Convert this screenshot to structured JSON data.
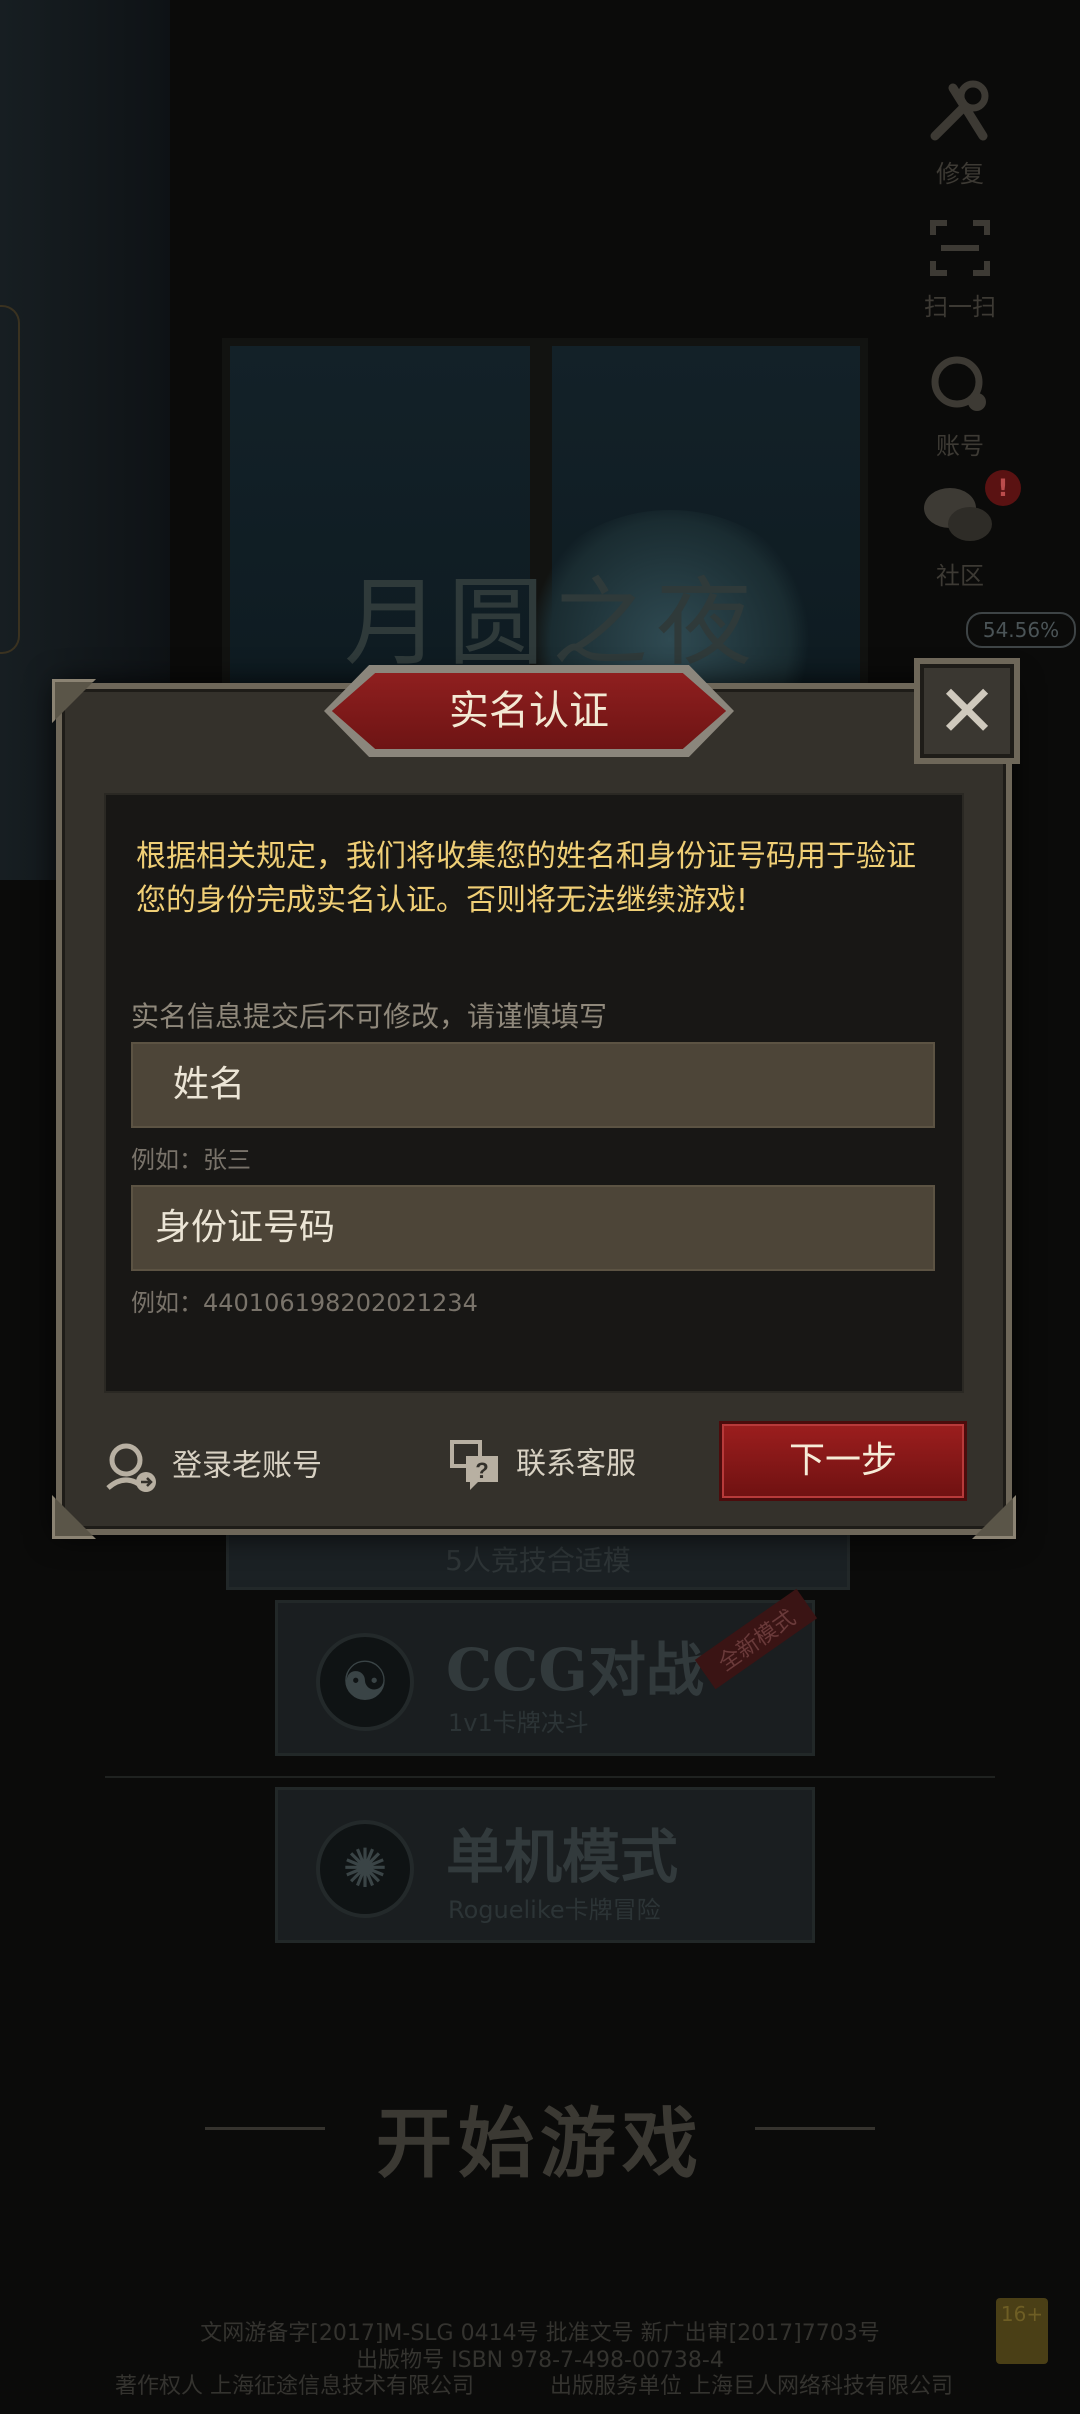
{
  "background": {
    "logo_text": "月圆之夜",
    "side_menu": [
      {
        "label": "修复",
        "icon": "wrench-icon"
      },
      {
        "label": "扫一扫",
        "icon": "scan-icon"
      },
      {
        "label": "账号",
        "icon": "account-gear-icon"
      },
      {
        "label": "社区",
        "icon": "chat-bubbles-icon",
        "badge": "!"
      }
    ],
    "download_progress": "54.56%",
    "partial_button_text": "5人竞技合适模",
    "modes": [
      {
        "title": "CCG对战",
        "subtitle": "1v1卡牌决斗",
        "ribbon": "全新模式",
        "icon": "swirl-emblem-icon"
      },
      {
        "title": "单机模式",
        "subtitle": "Roguelike卡牌冒险",
        "icon": "spiral-emblem-icon"
      }
    ],
    "start_game": "开始游戏",
    "footer": {
      "line1": "文网游备字[2017]M-SLG 0414号 批准文号 新广出审[2017]7703号",
      "line2": "出版物号 ISBN 978-7-498-00738-4",
      "line3_left": "著作权人 上海征途信息技术有限公司",
      "line3_right": "出版服务单位 上海巨人网络科技有限公司",
      "age_rating": "16+"
    }
  },
  "dialog": {
    "title": "实名认证",
    "close_icon": "close-icon",
    "notice": "根据相关规定，我们将收集您的姓名和身份证号码用于验证您的身份完成实名认证。否则将无法继续游戏!",
    "caption": "实名信息提交后不可修改，请谨慎填写",
    "name_field": {
      "placeholder": "姓名",
      "example": "例如：张三"
    },
    "id_field": {
      "placeholder": "身份证号码",
      "example": "例如：440106198202021234"
    },
    "login_old_account": "登录老账号",
    "contact_support": "联系客服",
    "next_button": "下一步"
  },
  "colors": {
    "accent_red": "#8f1f1f",
    "notice_gold": "#f0cf76",
    "frame": "#6e6759"
  }
}
